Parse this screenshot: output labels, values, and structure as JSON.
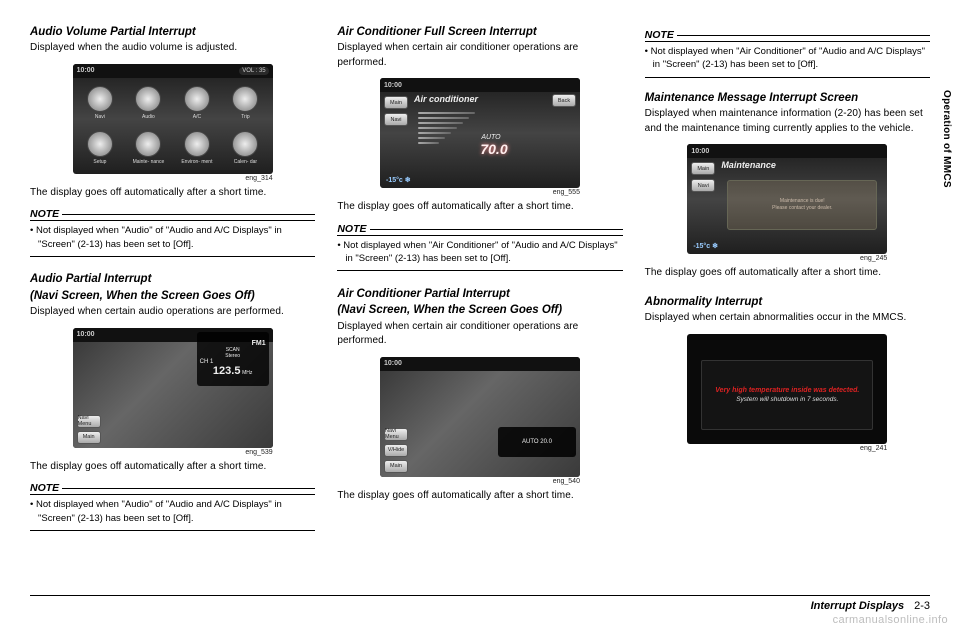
{
  "sidetab": "Operation of MMCS",
  "footer": {
    "section": "Interrupt Displays",
    "page": "2-3"
  },
  "watermark": "carmanualsonline.info",
  "col1": {
    "s1": {
      "title": "Audio Volume Partial Interrupt",
      "body": "Displayed when the audio volume is adjusted.",
      "caption": "eng_314",
      "after": "The display goes off automatically after a short time.",
      "note": "Not displayed when \"Audio\" of \"Audio and A/C Displays\" in \"Screen\" (2-13) has been set to [Off]."
    },
    "s2": {
      "title1": "Audio Partial Interrupt",
      "title2": "(Navi Screen, When the Screen Goes Off)",
      "body": "Displayed when certain audio operations are performed.",
      "caption": "eng_539",
      "after": "The display goes off automatically after a short time.",
      "note": "Not displayed when \"Audio\" of \"Audio and A/C Displays\" in \"Screen\" (2-13) has been set to [Off]."
    },
    "fig1": {
      "clock": "10:00",
      "vol": "VOL : 35",
      "labels": [
        "Navi",
        "Audio",
        "A/C",
        "Trip",
        "Setup",
        "Mainte-\nnance",
        "Environ-\nment",
        "Calen-\ndar"
      ]
    },
    "fig2": {
      "clock": "10:00",
      "btns": [
        "Navi Menu",
        "Main"
      ],
      "fm": "FM1",
      "scan": "SCAN",
      "stereo": "Stereo",
      "ch": "CH 1",
      "freq": "123.5",
      "unit": "MHz"
    }
  },
  "col2": {
    "s1": {
      "title": "Air Conditioner Full Screen Interrupt",
      "body": "Displayed when certain air conditioner operations are performed.",
      "caption": "eng_555",
      "after": "The display goes off automatically after a short time.",
      "note": "Not displayed when \"Air Conditioner\" of \"Audio and A/C Displays\" in \"Screen\" (2-13) has been set to [Off]."
    },
    "s2": {
      "title1": "Air Conditioner Partial Interrupt",
      "title2": "(Navi Screen, When the Screen Goes Off)",
      "body": "Displayed when certain air conditioner operations are performed.",
      "caption": "eng_540",
      "after": "The display goes off automatically after a short time."
    },
    "fig1": {
      "clock": "10:00",
      "title": "Air conditioner",
      "btns": [
        "Main",
        "Navi"
      ],
      "back": "Back",
      "auto": "AUTO",
      "temp": "70.0",
      "bottom": "-15°c ❄"
    },
    "fig2": {
      "clock": "10:00",
      "btns": [
        "Navi Menu",
        "V/Hide",
        "Main"
      ],
      "overlay": "AUTO 20.0"
    }
  },
  "col3": {
    "s0": {
      "note": "Not displayed when \"Air Conditioner\" of \"Audio and A/C Displays\" in \"Screen\" (2-13) has been set to [Off]."
    },
    "s1": {
      "title": "Maintenance Message Interrupt Screen",
      "body": "Displayed when maintenance information (2-20) has been set and the maintenance timing currently applies to the vehicle.",
      "caption": "eng_245",
      "after": "The display goes off automatically after a short time."
    },
    "s2": {
      "title": "Abnormality Interrupt",
      "body": "Displayed when certain abnormalities occur in the MMCS.",
      "caption": "eng_241"
    },
    "fig1": {
      "clock": "10:00",
      "title": "Maintenance",
      "btns": [
        "Main",
        "Navi"
      ],
      "bottom": "-15°c ❄",
      "msg1": "Maintenance is due!",
      "msg2": "Please contact your dealer."
    },
    "fig2": {
      "line1": "Very high temperature inside was detected.",
      "line2": "System will shutdown in 7 seconds."
    }
  },
  "labels": {
    "note": "NOTE"
  }
}
